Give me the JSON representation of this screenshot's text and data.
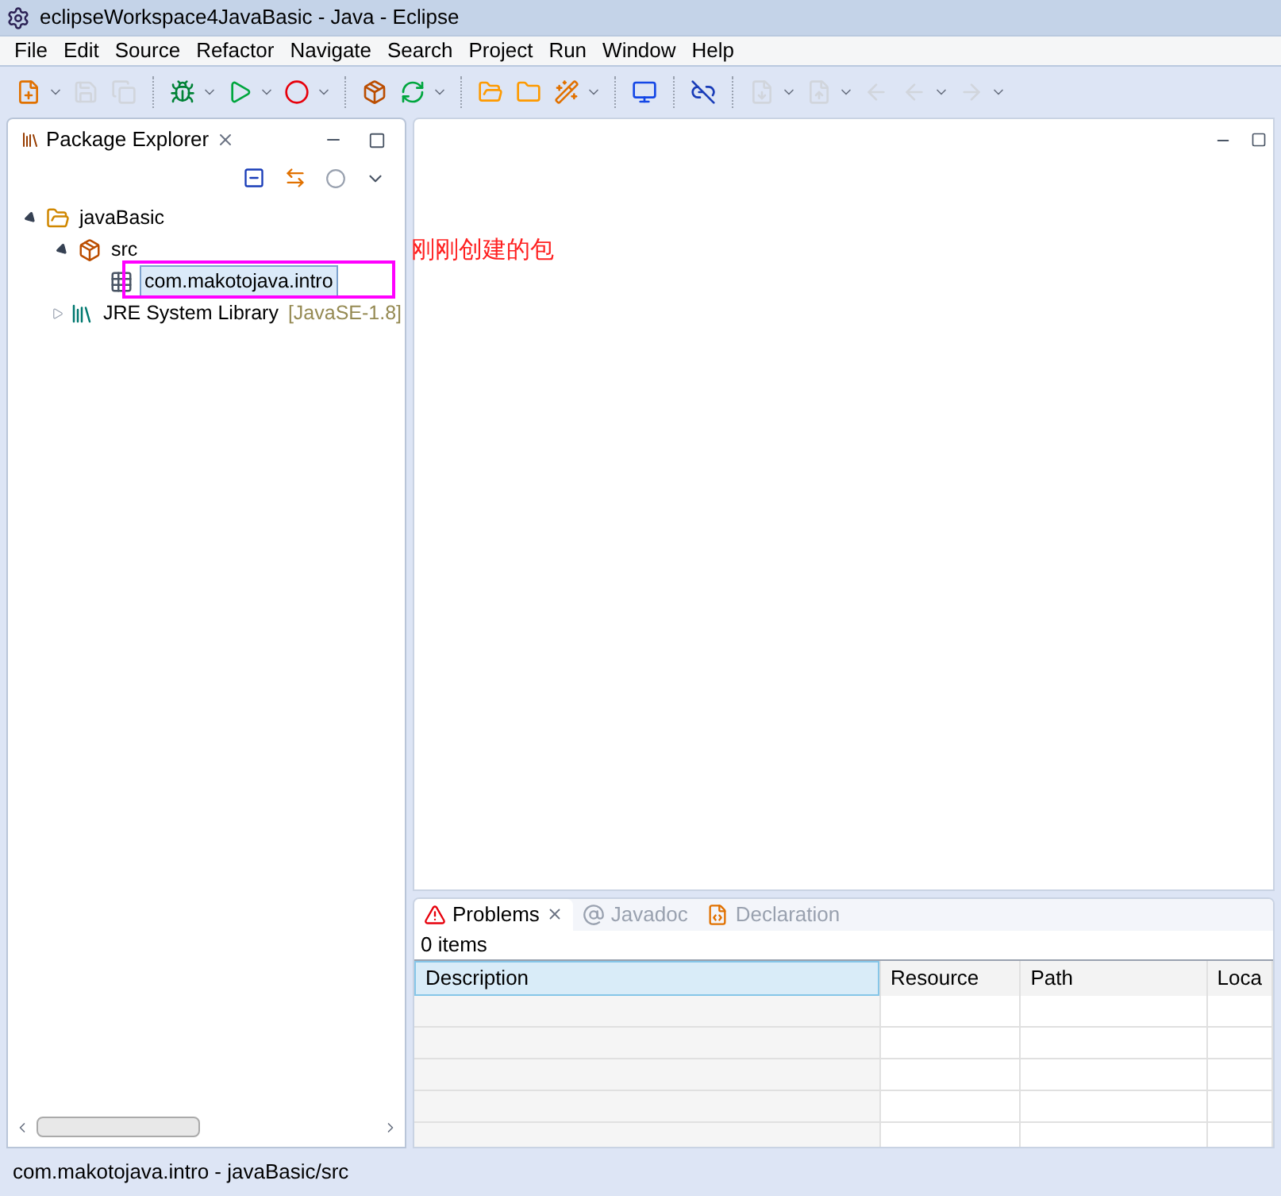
{
  "window": {
    "title": "eclipseWorkspace4JavaBasic - Java - Eclipse"
  },
  "menu": [
    "File",
    "Edit",
    "Source",
    "Refactor",
    "Navigate",
    "Search",
    "Project",
    "Run",
    "Window",
    "Help"
  ],
  "package_explorer": {
    "title": "Package Explorer",
    "tree": [
      {
        "label": "javaBasic",
        "kind": "project",
        "expanded": true,
        "children": [
          {
            "label": "src",
            "kind": "source-folder",
            "expanded": true,
            "children": [
              {
                "label": "com.makotojava.intro",
                "kind": "package",
                "selected": true
              }
            ]
          },
          {
            "label": "JRE System Library",
            "decoration": "[JavaSE-1.8]",
            "kind": "library",
            "expanded": false
          }
        ]
      }
    ]
  },
  "annotation": {
    "text": "刚刚创建的包"
  },
  "bottom_panel": {
    "tabs": [
      {
        "label": "Problems",
        "kind": "problems",
        "selected": true
      },
      {
        "label": "Javadoc",
        "kind": "javadoc",
        "selected": false
      },
      {
        "label": "Declaration",
        "kind": "declaration",
        "selected": false
      }
    ],
    "summary": "0 items",
    "table": {
      "columns": [
        {
          "label": "Description",
          "selected": true
        },
        {
          "label": "Resource",
          "selected": false
        },
        {
          "label": "Path",
          "selected": false
        },
        {
          "label": "Loca",
          "selected": false
        }
      ]
    }
  },
  "status_bar": "com.makotojava.intro - javaBasic/src"
}
